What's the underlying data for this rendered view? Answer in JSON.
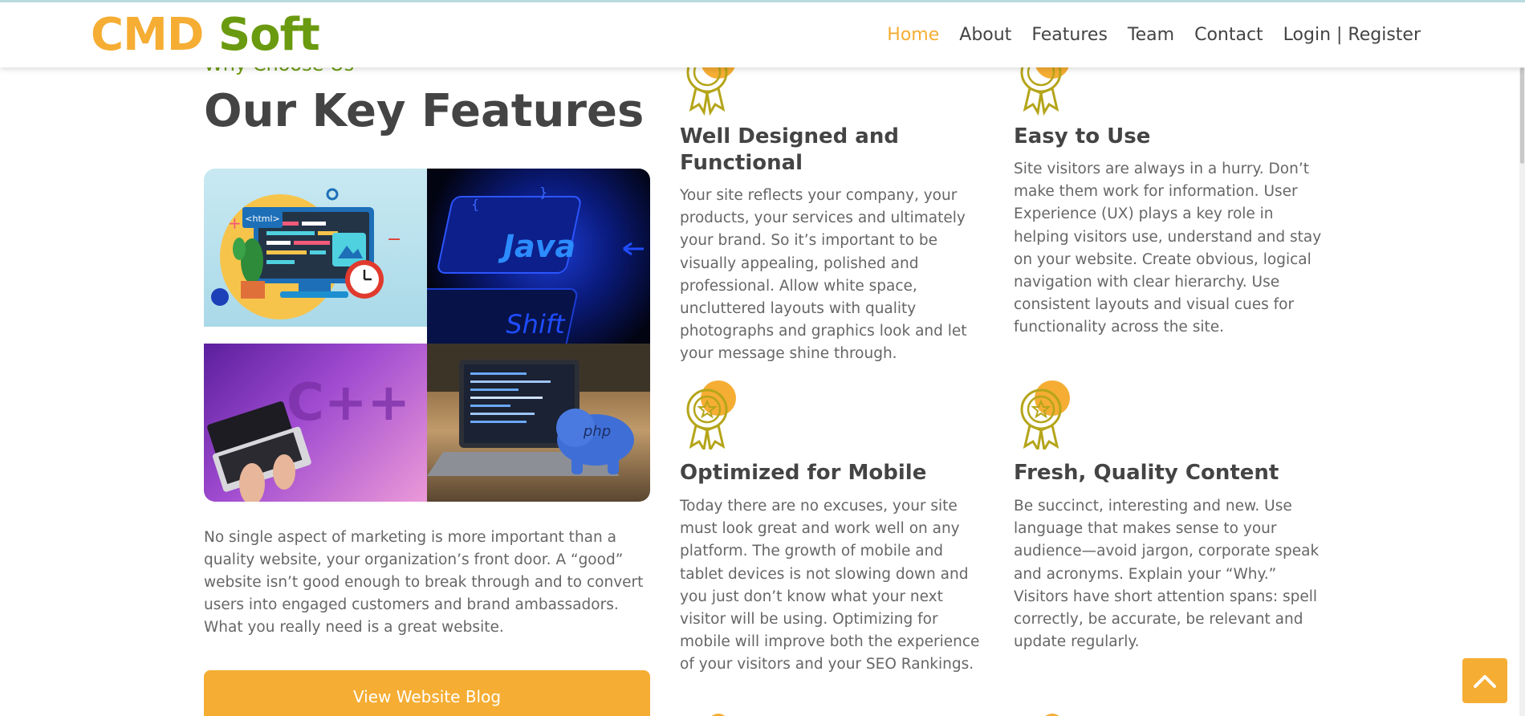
{
  "header": {
    "logo_part1": "CMD",
    "logo_part2": "Soft",
    "nav": [
      "Home",
      "About",
      "Features",
      "Team",
      "Contact",
      "Login | Register"
    ]
  },
  "section": {
    "eyebrow": "Why Choose Us",
    "title": "Our Key Features",
    "image_labels": {
      "html_tag": "<html>",
      "java_key": "Java",
      "shift_key": "Shift",
      "cpp_text": "C++",
      "php_text": "php"
    },
    "intro": "No single aspect of marketing is more important than a quality website, your organization’s front door. A “good” website isn’t good enough to break through and to convert users into engaged customers and brand ambassadors. What you really need is a great website.",
    "cta": "View Website Blog"
  },
  "features": [
    {
      "title": "Well Designed and Functional",
      "text": "Your site reflects your company, your products, your services and ultimately your brand. So it’s important to be visually appealing, polished and professional. Allow white space, uncluttered layouts with quality photographs and graphics look and let your message shine through."
    },
    {
      "title": "Easy to Use",
      "text": "Site visitors are always in a hurry. Don’t make them work for information. User Experience (UX) plays a key role in helping visitors use, understand and stay on your website. Create obvious, logical navigation with clear hierarchy. Use consistent layouts and visual cues for functionality across the site."
    },
    {
      "title": "Optimized for Mobile",
      "text": "Today there are no excuses, your site must look great and work well on any platform. The growth of mobile and tablet devices is not slowing down and you just don’t know what your next visitor will be using. Optimizing for mobile will improve both the experience of your visitors and your SEO Rankings."
    },
    {
      "title": "Fresh, Quality Content",
      "text": "Be succinct, interesting and new. Use language that makes sense to your audience—avoid jargon, corporate speak and acronyms. Explain your “Why.” Visitors have short attention spans: spell correctly, be accurate, be relevant and update regularly."
    }
  ],
  "icons": {
    "feature_badge": "award-medal-icon",
    "back_to_top": "chevron-up-icon"
  },
  "colors": {
    "accent": "#f5ad33",
    "brand_green": "#6a9a0f",
    "text": "#444444"
  }
}
